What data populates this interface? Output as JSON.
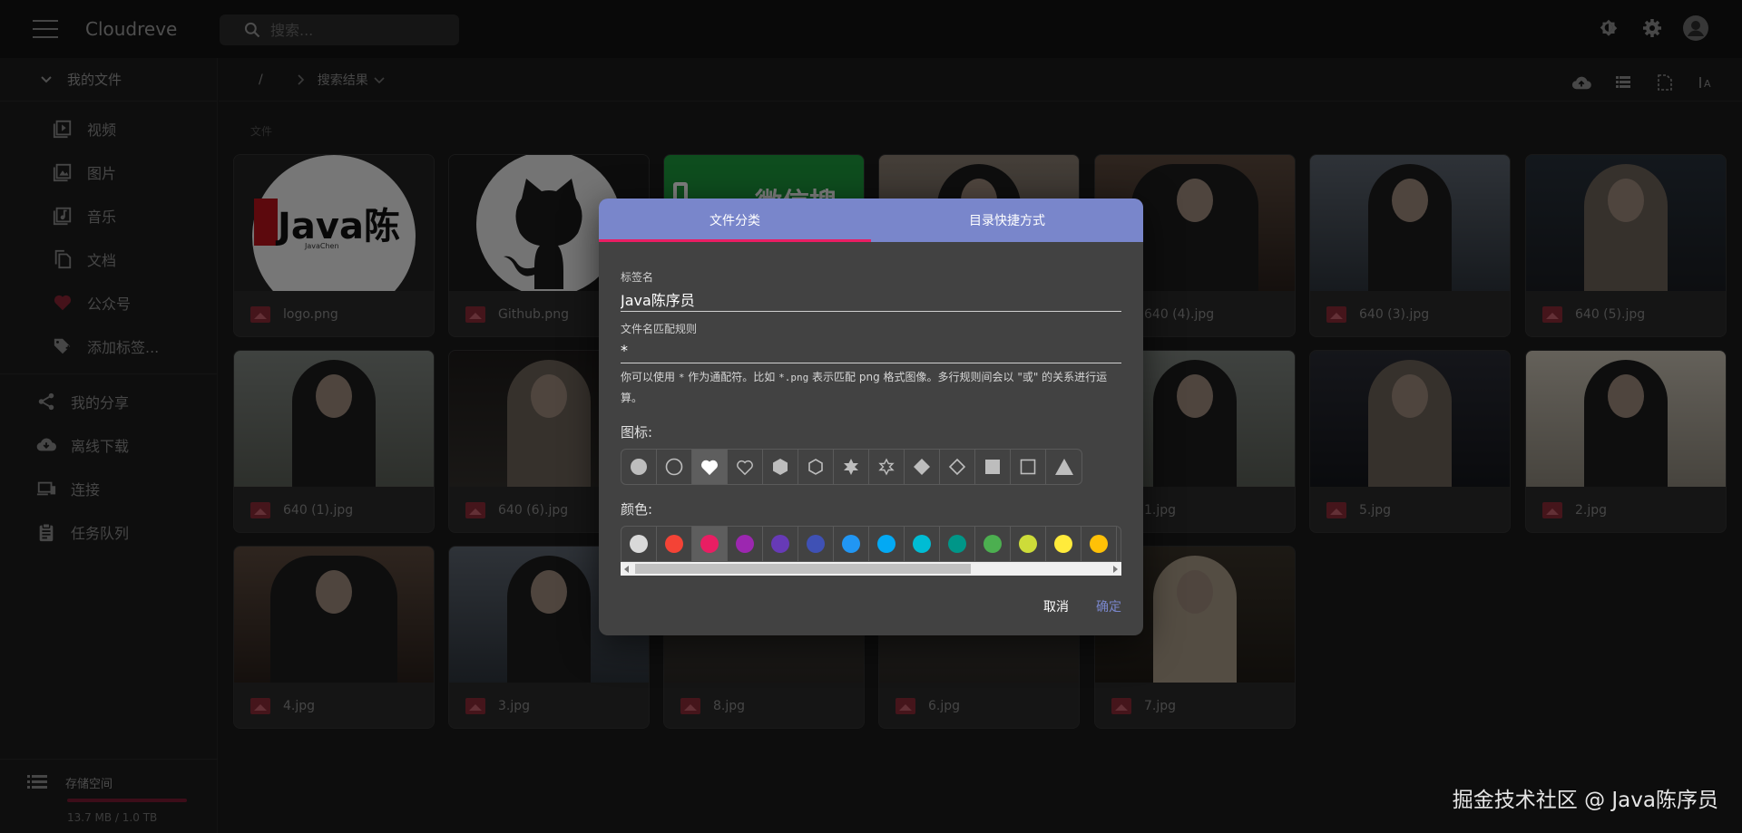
{
  "app": {
    "title": "Cloudreve"
  },
  "search": {
    "placeholder": "搜索..."
  },
  "sidebar": {
    "header": "我的文件",
    "categories": [
      {
        "label": "视频",
        "icon": "video-icon"
      },
      {
        "label": "图片",
        "icon": "image-icon"
      },
      {
        "label": "音乐",
        "icon": "music-icon"
      },
      {
        "label": "文档",
        "icon": "document-icon"
      },
      {
        "label": "公众号",
        "icon": "heart-icon"
      },
      {
        "label": "添加标签...",
        "icon": "add-tag-icon"
      }
    ],
    "items": [
      {
        "label": "我的分享",
        "icon": "share-icon"
      },
      {
        "label": "离线下载",
        "icon": "cloud-download-icon"
      },
      {
        "label": "连接",
        "icon": "devices-icon"
      },
      {
        "label": "任务队列",
        "icon": "clipboard-icon"
      }
    ],
    "storage": {
      "label": "存储空间",
      "size": "13.7 MB / 1.0 TB"
    }
  },
  "breadcrumb": {
    "root": "/",
    "current": "搜索结果"
  },
  "main": {
    "section_label": "文件",
    "files": [
      "logo.png",
      "Github.png",
      "",
      "",
      "640 (4).jpg",
      "640 (3).jpg",
      "640 (5).jpg",
      "640 (1).jpg",
      "640 (6).jpg",
      "",
      "",
      "1.jpg",
      "5.jpg",
      "2.jpg",
      "4.jpg",
      "3.jpg",
      "8.jpg",
      "6.jpg",
      "7.jpg"
    ],
    "thumb_texts": {
      "logo": "Java陈",
      "logo_sub": "JavaChen",
      "wechat": "微信搜"
    }
  },
  "dialog": {
    "tabs": [
      "文件分类",
      "目录快捷方式"
    ],
    "active_tab": 0,
    "tag_name_label": "标签名",
    "tag_name_value": "Java陈序员",
    "pattern_label": "文件名匹配规则",
    "pattern_value": "*",
    "helper_parts": [
      "你可以使用 ",
      "*",
      " 作为通配符。比如 ",
      "*.png",
      " 表示匹配 png 格式图像。多行规则间会以 \"或\" 的关系进行运算。"
    ],
    "icon_label": "图标:",
    "icons": [
      "circle-filled-icon",
      "circle-outline-icon",
      "heart-filled-icon",
      "heart-outline-icon",
      "hexagon-filled-icon",
      "hexagon-outline-icon",
      "star-filled-icon",
      "star-outline-icon",
      "diamond-filled-icon",
      "diamond-outline-icon",
      "square-filled-icon",
      "square-outline-icon",
      "triangle-filled-icon"
    ],
    "selected_icon": 2,
    "color_label": "颜色:",
    "colors": [
      "#d9d9d9",
      "#f44336",
      "#e91e63",
      "#9c27b0",
      "#673ab7",
      "#3f51b5",
      "#2196f3",
      "#03a9f4",
      "#00bcd4",
      "#009688",
      "#4caf50",
      "#cddc39",
      "#ffeb3b",
      "#ffc107"
    ],
    "selected_color": 2,
    "cancel": "取消",
    "confirm": "确定"
  },
  "accent": {
    "primary": "#7986cb",
    "secondary": "#e91e63"
  },
  "watermark": "掘金技术社区 @ Java陈序员"
}
